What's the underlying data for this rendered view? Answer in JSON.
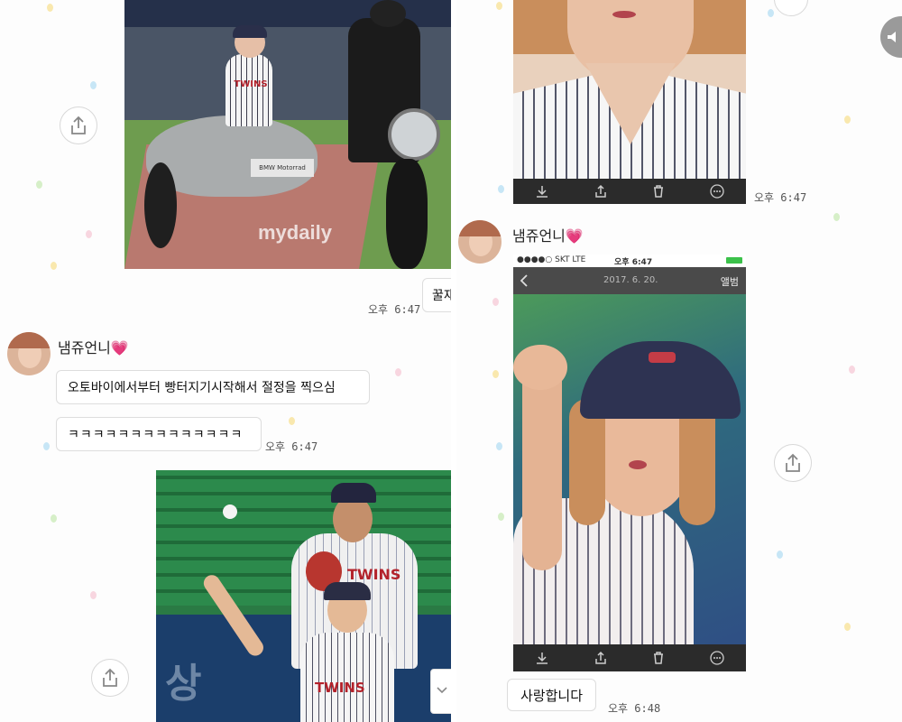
{
  "colors": {
    "accent_pink": "#e2579b",
    "toolbar_bg": "#2b2b2b",
    "bubble_border": "#dddddd",
    "timestamp": "#555555"
  },
  "left_panel": {
    "top_photo": {
      "watermark": "mydaily",
      "sidecar_text": "BMW Motorrad",
      "jersey_text": "TWINS"
    },
    "sent_bubble_partial": {
      "text": "꿀재"
    },
    "sent_time": "오후 6:47",
    "sender": {
      "name": "냄쥬언니",
      "heart": "💗"
    },
    "messages": [
      {
        "text": "오토바이에서부터 빵터지기시작해서 절정을 찍으심"
      },
      {
        "text": "ㅋㅋㅋㅋㅋㅋㅋㅋㅋㅋㅋㅋㅋㅋ",
        "time": "오후 6:47"
      }
    ],
    "bottom_photo": {
      "jersey_text": "TWINS",
      "banner_text": "상"
    }
  },
  "right_panel": {
    "top_time": "오후 6:47",
    "toolbar_icons": [
      "download-icon",
      "share-icon",
      "trash-icon",
      "more-icon"
    ],
    "sender": {
      "name": "냄쥬언니",
      "heart": "💗"
    },
    "screenshot": {
      "status_left": "●●●●○ SKT LTE",
      "status_time": "오후 6:47",
      "date": "2017. 6. 20.",
      "album_label": "앨범"
    },
    "reply": {
      "text": "사랑합니다",
      "time": "오후 6:48"
    }
  }
}
